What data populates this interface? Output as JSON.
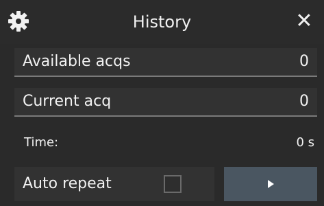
{
  "header": {
    "title": "History",
    "settings_icon": "gear-icon",
    "close_icon": "close-icon",
    "close_glyph": "✕"
  },
  "fields": {
    "available_acqs": {
      "label": "Available acqs",
      "value": "0"
    },
    "current_acq": {
      "label": "Current acq",
      "value": "0"
    },
    "time": {
      "label": "Time:",
      "value": "0 s"
    }
  },
  "controls": {
    "auto_repeat": {
      "label": "Auto repeat",
      "checked": false
    },
    "play_icon": "play-icon"
  },
  "colors": {
    "background": "#2a2a2a",
    "field_bg": "#323232",
    "play_button_bg": "#4a5661",
    "text": "#f2f2f2"
  }
}
